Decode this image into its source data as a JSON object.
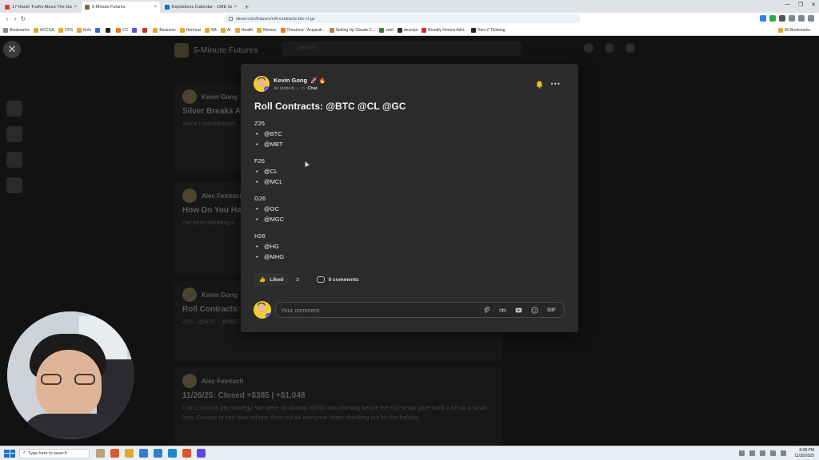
{
  "browser": {
    "tabs": [
      {
        "label": "17 Harsh Truths About The Game of",
        "favicon_color": "#e33b2e",
        "active": false
      },
      {
        "label": "5-Minute Futures",
        "favicon_color": "#7a6a3a",
        "active": true
      },
      {
        "label": "Expirations Calendar - CME Group",
        "favicon_color": "#1a6fc2",
        "active": false
      }
    ],
    "url": "skool.com/futures/roll-contracts-btc-cl-gc",
    "bookmarks": [
      "Bookmarks",
      "ACCGA",
      "CPS",
      "Kirfs",
      "CC",
      "Business",
      "Hormozi",
      "BA",
      "AI",
      "Health",
      "Memes",
      "Checkout - Acquisiti...",
      "Setting Up Claude C...",
      "vetd",
      "descript",
      "Brutally Honest Advi...",
      "Kiev Z Thinking"
    ],
    "all_bookmarks": "All Bookmarks"
  },
  "background": {
    "community_name": "5-Minute Futures",
    "search_placeholder": "Search",
    "posts": [
      {
        "author": "Kevin Gong",
        "title": "Silver Breaks A",
        "body": "Since I started posti... to $57 That's a $50..."
      },
      {
        "author": "Alec Feintuch",
        "title": "How Do You Ha",
        "body": "I've been thinking a... now, and one of the"
      },
      {
        "author": "Kevin Gong",
        "title": "Roll Contracts:",
        "body": "Z25 - @BTC - @MBT"
      },
      {
        "author": "Alec Feintuch",
        "title": "11/26/25: Closed +$385 | +$1,048",
        "body": "I run 2 micros per strategy. We were up around +$750 this morning before the NQ setup gave back a bit on a small loss. Curious to see how volume thins out as everyone starts checking out for the holiday."
      }
    ]
  },
  "modal": {
    "author": "Kevin Gong",
    "author_emojis": "🚀 🔥",
    "level": "6",
    "time": "4d (edited)",
    "channel": "Chat",
    "more_label": "•••",
    "title": "Roll Contracts: @BTC @CL @GC",
    "groups": [
      {
        "code": "Z25",
        "items": [
          "@BTC",
          "@MBT"
        ]
      },
      {
        "code": "F26",
        "items": [
          "@CL",
          "@MCL"
        ]
      },
      {
        "code": "G26",
        "items": [
          "@GC",
          "@MGC"
        ]
      },
      {
        "code": "H26",
        "items": [
          "@HG",
          "@MHG"
        ]
      }
    ],
    "liked_label": "Liked",
    "like_count": "3",
    "comments_label": "0 comments",
    "comment_placeholder": "Your comment",
    "gif_label": "GIF"
  },
  "taskbar": {
    "search_placeholder": "Type here to search",
    "time": "8:08 PM",
    "date": "11/30/2025"
  },
  "colors": {
    "accent_yellow": "#f2cd2e",
    "bell": "#f0c419",
    "modal_bg": "#2b2b2c"
  }
}
